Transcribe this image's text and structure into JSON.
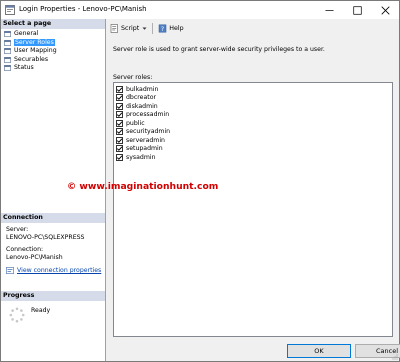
{
  "window": {
    "title": "Login Properties - Lenovo-PC\\Manish"
  },
  "left_pane": {
    "select_page_header": "Select a page",
    "pages": [
      {
        "label": "General",
        "selected": false
      },
      {
        "label": "Server Roles",
        "selected": true
      },
      {
        "label": "User Mapping",
        "selected": false
      },
      {
        "label": "Securables",
        "selected": false
      },
      {
        "label": "Status",
        "selected": false
      }
    ],
    "connection_header": "Connection",
    "server_label": "Server:",
    "server_value": "LENOVO-PC\\SQLEXPRESS",
    "connection_label": "Connection:",
    "connection_value": "Lenovo-PC\\Manish",
    "view_connection_link": "View connection properties",
    "progress_header": "Progress",
    "progress_status": "Ready"
  },
  "toolbar": {
    "script_label": "Script",
    "help_label": "Help"
  },
  "main": {
    "description": "Server role is used to grant server-wide security privileges to a user.",
    "roles_label": "Server roles:",
    "roles": [
      {
        "name": "bulkadmin",
        "checked": true
      },
      {
        "name": "dbcreator",
        "checked": true
      },
      {
        "name": "diskadmin",
        "checked": true
      },
      {
        "name": "processadmin",
        "checked": true
      },
      {
        "name": "public",
        "checked": true
      },
      {
        "name": "securityadmin",
        "checked": true
      },
      {
        "name": "serveradmin",
        "checked": true
      },
      {
        "name": "setupadmin",
        "checked": true
      },
      {
        "name": "sysadmin",
        "checked": true
      }
    ],
    "watermark": "© www.imaginationhunt.com"
  },
  "buttons": {
    "ok_label": "OK",
    "cancel_label": "Cancel"
  },
  "colors": {
    "selection": "#3399ff",
    "section_header": "#d6dbe9",
    "watermark": "#d20000"
  }
}
